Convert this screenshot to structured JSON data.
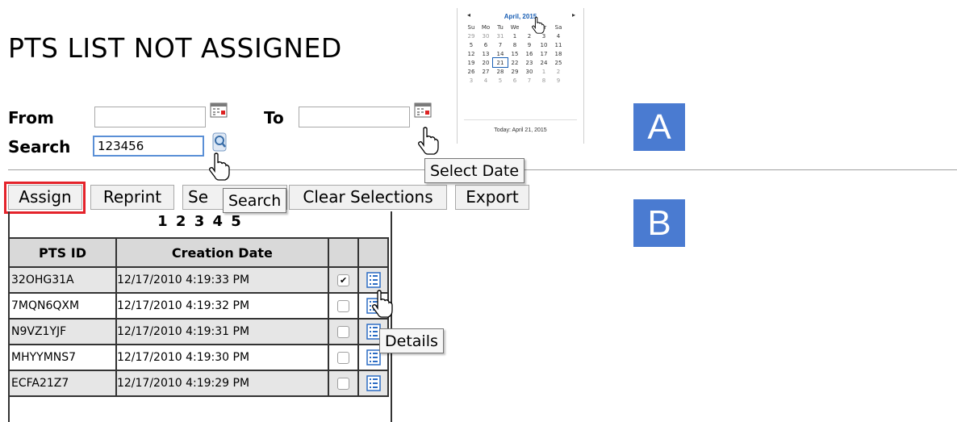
{
  "page": {
    "title": "PTS LIST NOT ASSIGNED"
  },
  "filters": {
    "from_label": "From",
    "from_value": "",
    "to_label": "To",
    "to_value": "",
    "search_label": "Search",
    "search_value": "123456"
  },
  "calendar": {
    "month": "April, 2015",
    "prev": "◂",
    "next": "▸",
    "weekdays": [
      "Su",
      "Mo",
      "Tu",
      "We",
      "",
      "Fr",
      "Sa"
    ],
    "weeks": [
      [
        "29",
        "30",
        "31",
        "1",
        "2",
        "3",
        "4"
      ],
      [
        "5",
        "6",
        "7",
        "8",
        "9",
        "10",
        "11"
      ],
      [
        "12",
        "13",
        "14",
        "15",
        "16",
        "17",
        "18"
      ],
      [
        "19",
        "20",
        "21",
        "22",
        "23",
        "24",
        "25"
      ],
      [
        "26",
        "27",
        "28",
        "29",
        "30",
        "1",
        "2"
      ],
      [
        "3",
        "4",
        "5",
        "6",
        "7",
        "8",
        "9"
      ]
    ],
    "selected": "21",
    "today_text": "Today: April 21, 2015"
  },
  "badges": {
    "a": "A",
    "b": "B"
  },
  "toolbar": {
    "assign": "Assign",
    "reprint": "Reprint",
    "select_partial": "Se",
    "clear": "Clear Selections",
    "export": "Export"
  },
  "tooltips": {
    "select_date": "Select Date",
    "search": "Search",
    "details": "Details"
  },
  "grid": {
    "pager": "1 2 3 4 5",
    "columns": [
      "PTS ID",
      "Creation Date",
      "",
      ""
    ],
    "rows": [
      {
        "id": "32OHG31A",
        "date": "12/17/2010 4:19:33 PM",
        "checked": true
      },
      {
        "id": "7MQN6QXM",
        "date": "12/17/2010 4:19:32 PM",
        "checked": false
      },
      {
        "id": "N9VZ1YJF",
        "date": "12/17/2010 4:19:31 PM",
        "checked": false
      },
      {
        "id": "MHYYMNS7",
        "date": "12/17/2010 4:19:30 PM",
        "checked": false
      },
      {
        "id": "ECFA21Z7",
        "date": "12/17/2010 4:19:29 PM",
        "checked": false
      }
    ]
  },
  "colors": {
    "badge": "#4a7bd1",
    "highlight": "#e4232b",
    "calendar_accent": "#1a5fb4"
  },
  "icons": {
    "calendar": "calendar-icon",
    "search": "magnifier-icon",
    "details": "details-list-icon",
    "cursor": "hand-pointer-icon"
  }
}
